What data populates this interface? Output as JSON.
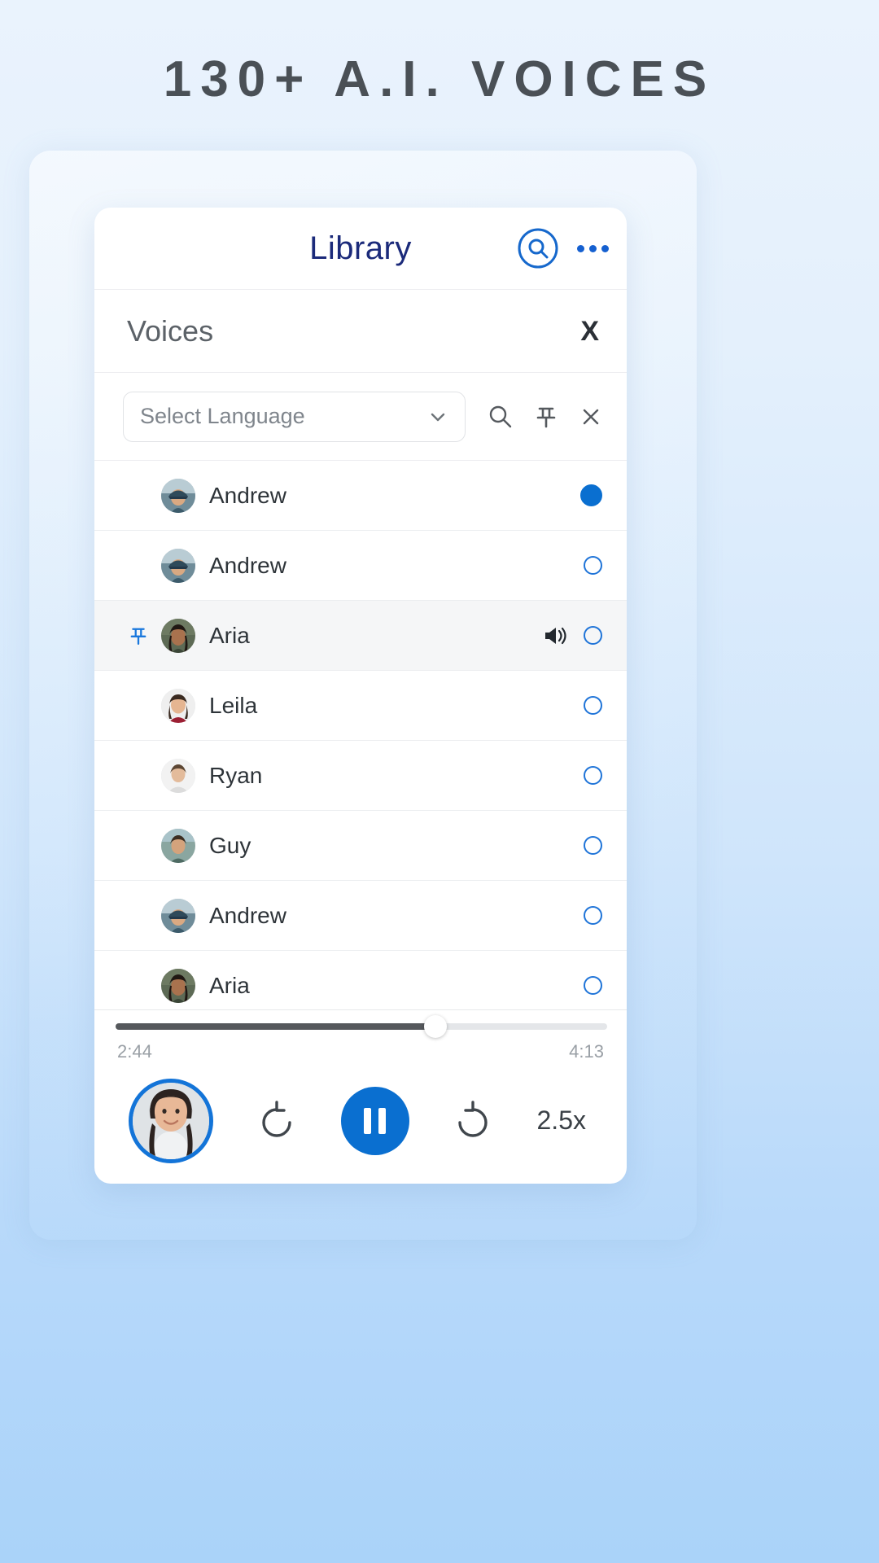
{
  "headline": "130+ A.I. VOICES",
  "app": {
    "title": "Library",
    "header_icons": {
      "search": "search-circle-icon",
      "more": "more-horizontal-icon"
    }
  },
  "panel": {
    "title": "Voices",
    "close_label": "X"
  },
  "filter": {
    "select_placeholder": "Select Language",
    "chevron": "chevron-down-icon",
    "icons": [
      "search-icon",
      "pin-icon",
      "close-icon"
    ]
  },
  "voices": [
    {
      "name": "Andrew",
      "selected": true,
      "pinned": false,
      "speaking": false,
      "avatar": "man-cap"
    },
    {
      "name": "Andrew",
      "selected": false,
      "pinned": false,
      "speaking": false,
      "avatar": "man-cap"
    },
    {
      "name": "Aria",
      "selected": false,
      "pinned": true,
      "speaking": true,
      "avatar": "woman-dark"
    },
    {
      "name": "Leila",
      "selected": false,
      "pinned": false,
      "speaking": false,
      "avatar": "woman-red"
    },
    {
      "name": "Ryan",
      "selected": false,
      "pinned": false,
      "speaking": false,
      "avatar": "person-light"
    },
    {
      "name": "Guy",
      "selected": false,
      "pinned": false,
      "speaking": false,
      "avatar": "man-outdoor"
    },
    {
      "name": "Andrew",
      "selected": false,
      "pinned": false,
      "speaking": false,
      "avatar": "man-cap"
    },
    {
      "name": "Aria",
      "selected": false,
      "pinned": false,
      "speaking": false,
      "avatar": "woman-dark"
    }
  ],
  "player": {
    "current_time": "2:44",
    "total_time": "4:13",
    "progress_percent": 65,
    "speed": "2.5x",
    "state": "playing",
    "rewind_icon": "rotate-left-icon",
    "forward_icon": "rotate-right-icon",
    "play_pause_icon": "pause-icon"
  },
  "colors": {
    "accent": "#0a6fd0",
    "title": "#1b2a7a",
    "headline": "#4a5056",
    "muted": "#9aa0a6"
  }
}
